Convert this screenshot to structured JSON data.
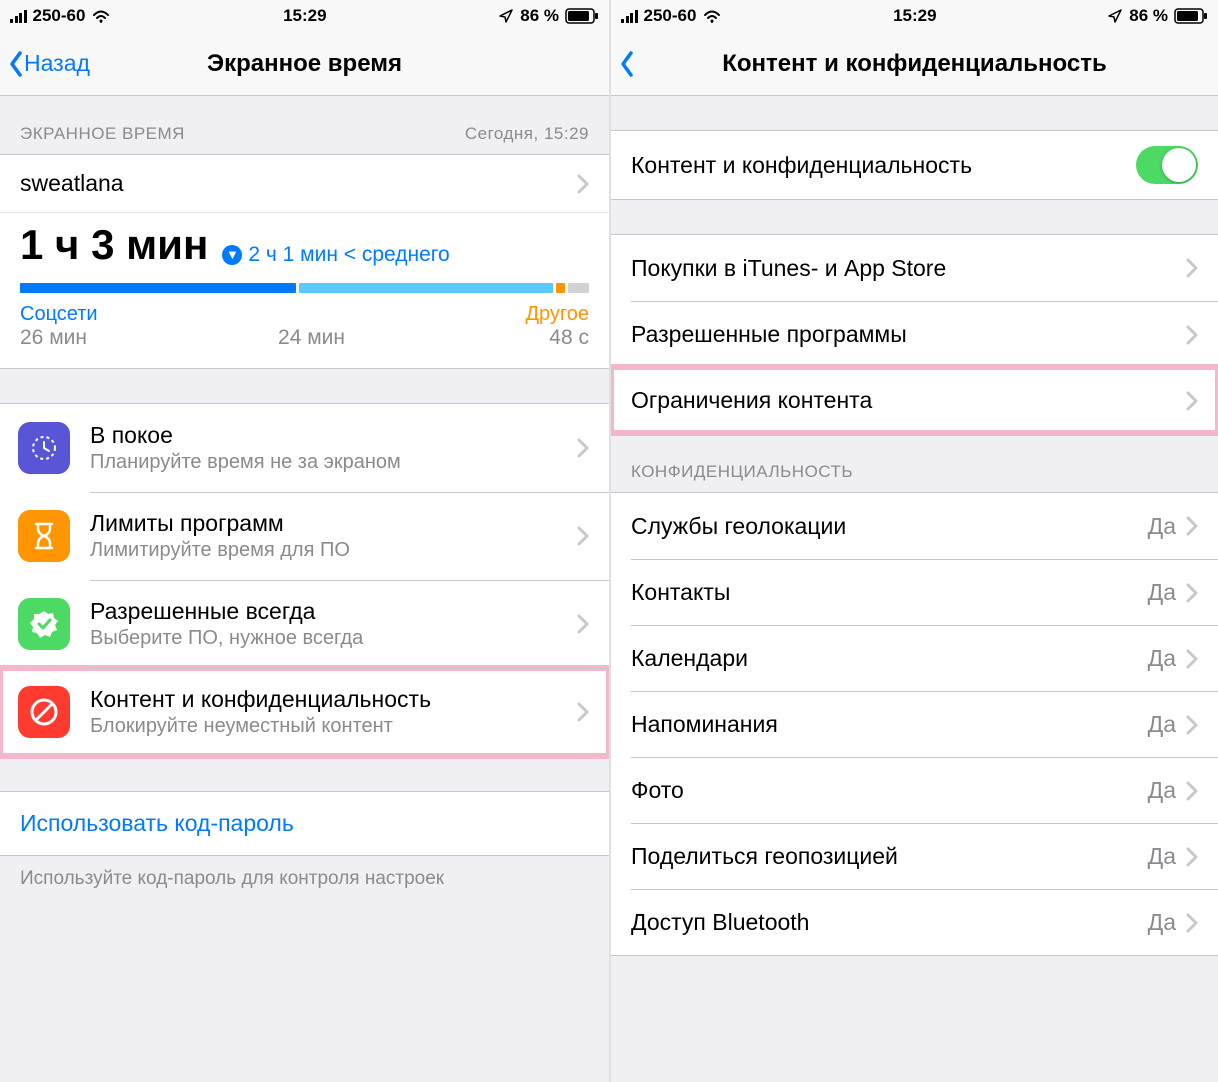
{
  "status": {
    "carrier": "250-60",
    "time": "15:29",
    "battery_pct": "86 %"
  },
  "left": {
    "back_label": "Назад",
    "title": "Экранное время",
    "section_header": "ЭКРАННОЕ ВРЕМЯ",
    "section_time": "Сегодня, 15:29",
    "username": "sweatlana",
    "total_time": "1 ч 3 мин",
    "compare_text": "2 ч 1 мин < среднего",
    "cat1_label": "Соцсети",
    "cat1_time": "26 мин",
    "cat2_time": "24 мин",
    "cat3_label": "Другое",
    "cat3_time": "48 с",
    "menu": [
      {
        "title": "В покое",
        "sub": "Планируйте время не за экраном",
        "color": "#5856d6"
      },
      {
        "title": "Лимиты программ",
        "sub": "Лимитируйте время для ПО",
        "color": "#ff9500"
      },
      {
        "title": "Разрешенные всегда",
        "sub": "Выберите ПО, нужное всегда",
        "color": "#4cd964"
      },
      {
        "title": "Контент и конфиденциальность",
        "sub": "Блокируйте неуместный контент",
        "color": "#ff3b30"
      }
    ],
    "passcode_link": "Использовать код-пароль",
    "footer": "Используйте код-пароль для контроля настроек"
  },
  "right": {
    "title": "Контент и конфиденциальность",
    "toggle_label": "Контент и конфиденциальность",
    "group1": [
      "Покупки в iTunes- и App Store",
      "Разрешенные программы",
      "Ограничения контента"
    ],
    "privacy_header": "КОНФИДЕНЦИАЛЬНОСТЬ",
    "privacy_items": [
      {
        "label": "Службы геолокации",
        "value": "Да"
      },
      {
        "label": "Контакты",
        "value": "Да"
      },
      {
        "label": "Календари",
        "value": "Да"
      },
      {
        "label": "Напоминания",
        "value": "Да"
      },
      {
        "label": "Фото",
        "value": "Да"
      },
      {
        "label": "Поделиться геопозицией",
        "value": "Да"
      },
      {
        "label": "Доступ Bluetooth",
        "value": "Да"
      }
    ]
  }
}
